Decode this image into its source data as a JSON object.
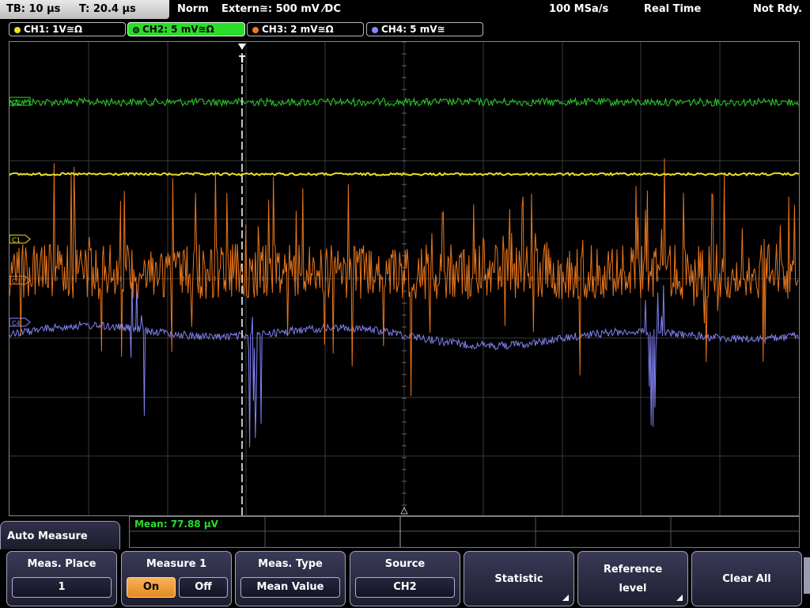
{
  "status": {
    "timebase": "TB: 10 µs",
    "trigger_pos": "T: 20.4 µs",
    "mode": "Norm",
    "trigger": "Extern≅: 500 mV ⁄DC",
    "sample_rate": "100 MSa/s",
    "acq_mode": "Real Time",
    "state": "Not Rdy."
  },
  "channels": [
    {
      "label": "CH1: 1V≅Ω",
      "color": "#f0e020",
      "marker": "C1"
    },
    {
      "label": "CH2: 5 mV≅Ω",
      "color": "#2bdc2b",
      "marker": "C2"
    },
    {
      "label": "CH3: 2 mV≅Ω",
      "color": "#f07a20",
      "marker": "C3"
    },
    {
      "label": "CH4: 5 mV≅",
      "color": "#8888ff",
      "marker": "C4"
    }
  ],
  "trigger_marker": "T",
  "measurement": {
    "mean": "Mean: 77.88 µV"
  },
  "menu": {
    "title": "Auto Measure",
    "meas_place": {
      "title": "Meas. Place",
      "value": "1"
    },
    "measure1": {
      "title": "Measure 1",
      "on": "On",
      "off": "Off"
    },
    "meas_type": {
      "title": "Meas. Type",
      "value": "Mean Value"
    },
    "source": {
      "title": "Source",
      "value": "CH2"
    },
    "statistic": "Statistic",
    "reference_level": {
      "line1": "Reference",
      "line2": "level"
    },
    "clear_all": "Clear All"
  }
}
